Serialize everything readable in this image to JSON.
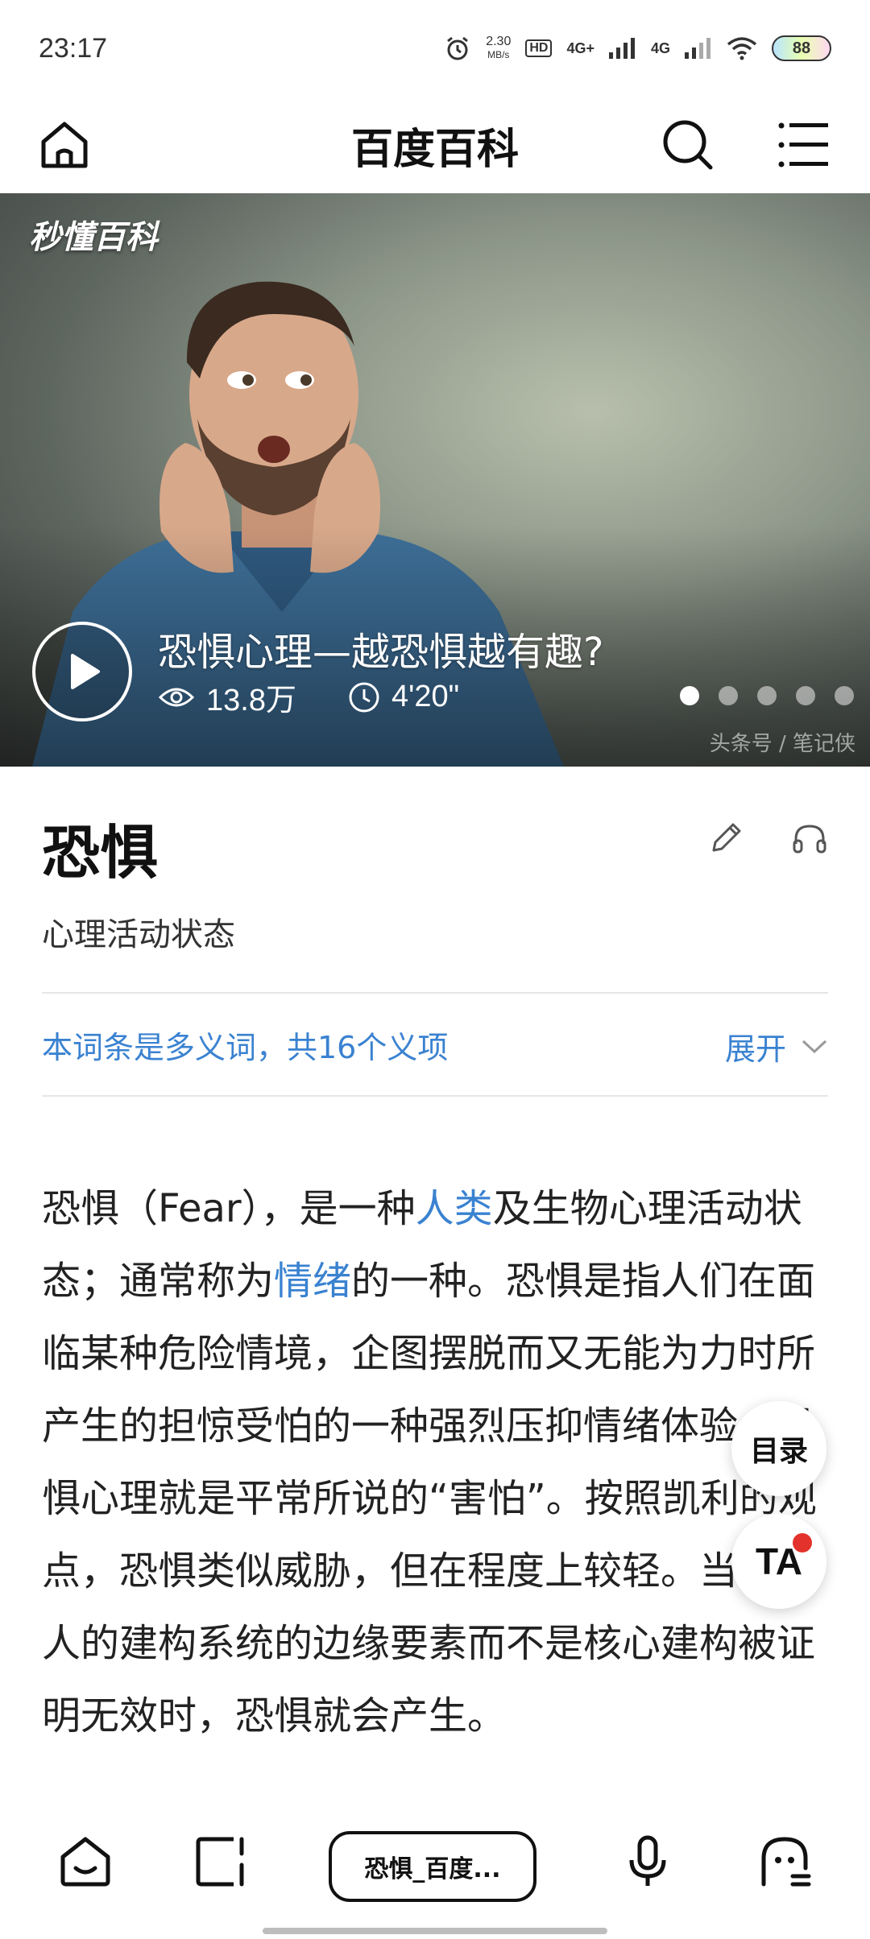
{
  "status_bar": {
    "time": "23:17",
    "speed_value": "2.30",
    "speed_unit": "MB/s",
    "hd_label": "HD",
    "net1": "4G+",
    "net2": "4G",
    "battery": "88"
  },
  "header": {
    "title": "百度百科"
  },
  "banner": {
    "brand": "秒懂百科",
    "video_title": "恐惧心理—越恐惧越有趣?",
    "views": "13.8万",
    "duration": "4'20\"",
    "source": "头条号 / 笔记侠",
    "slide_count": 5,
    "active_slide": 1
  },
  "entry": {
    "title": "恐惧",
    "subtitle": "心理活动状态",
    "polysemy_text": "本词条是多义词，共16个义项",
    "expand_label": "展开"
  },
  "content": {
    "p1": "恐惧（Fear），是一种",
    "link1": "人类",
    "p2": "及生物心理活动状态；通常称为",
    "link2": "情绪",
    "p3": "的一种。恐惧是指人们在面临某种危险情境，企图摆脱而又无能为力时所产生的担惊受怕的一种强烈压抑情绪体验。恐惧心理就是平常所说的“害怕”。按照凯利的观点，恐惧类似威胁，但在程度上较轻。当一个人的建构系统的边缘要素而不是核心建构被证明无效时，恐惧就会产生。"
  },
  "floating": {
    "toc_label": "目录",
    "ta_label": "TA"
  },
  "bottom_nav": {
    "tab_label": "恐惧_百度..."
  },
  "colors": {
    "link": "#3a82d1",
    "badge_red": "#e3322b"
  }
}
